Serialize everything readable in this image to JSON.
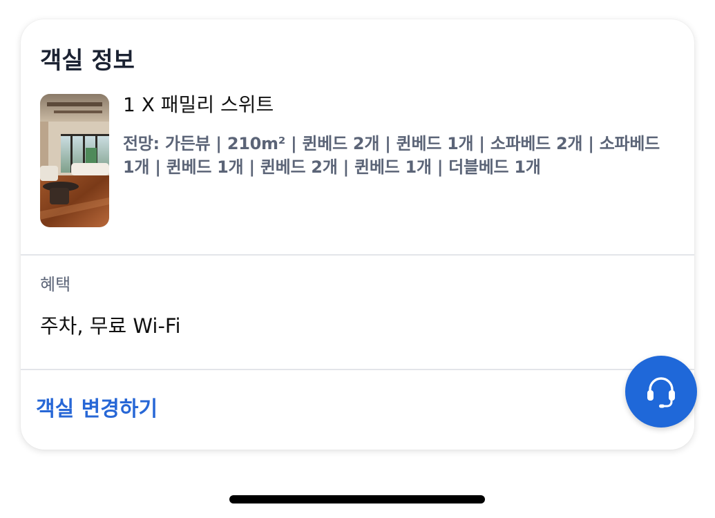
{
  "room_info": {
    "title": "객실 정보",
    "room": {
      "photo_icon": "room-photo",
      "name": "1 X 패밀리 스위트",
      "description": "전망: 가든뷰 | 210m² | 퀸베드 2개 | 퀸베드 1개 | 소파베드 2개 | 소파베드 1개 | 퀸베드 1개 | 퀸베드 2개 | 퀸베드 1개 | 더블베드 1개"
    }
  },
  "benefits": {
    "label": "혜택",
    "value": "주차, 무료 Wi-Fi"
  },
  "actions": {
    "change_room_label": "객실 변경하기"
  },
  "support": {
    "icon": "headset-icon"
  },
  "colors": {
    "accent": "#1f68d9",
    "link": "#2767d6",
    "muted_text": "#5b6477",
    "title_text": "#1c2333",
    "divider": "#e3e5e9"
  }
}
